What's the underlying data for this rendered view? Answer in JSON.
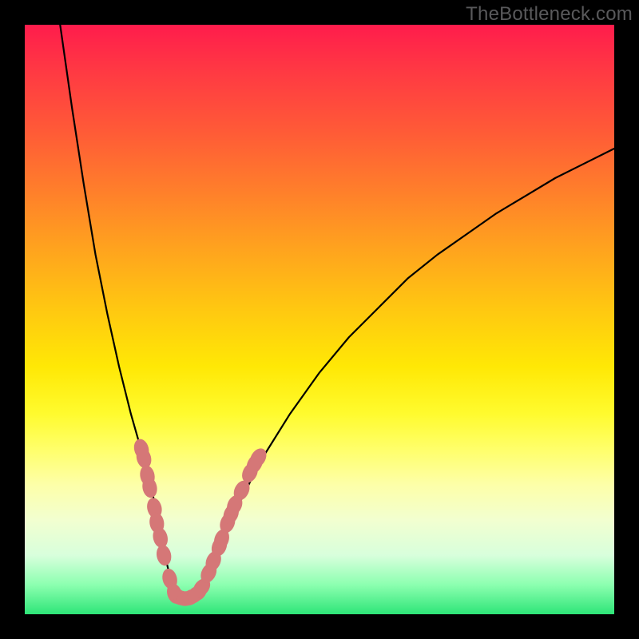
{
  "watermark": "TheBottleneck.com",
  "colors": {
    "frame": "#000000",
    "curve_stroke": "#000000",
    "marker_fill": "#D57777",
    "gradient_top": "#FF1C4C",
    "gradient_bottom": "#2EE578"
  },
  "chart_data": {
    "type": "line",
    "title": "",
    "xlabel": "",
    "ylabel": "",
    "xlim": [
      0,
      100
    ],
    "ylim": [
      0,
      100
    ],
    "grid": false,
    "series": [
      {
        "name": "bottleneck-curve",
        "x": [
          6.0,
          8.0,
          10.0,
          12.0,
          14.0,
          16.0,
          18.0,
          20.0,
          21.0,
          22.0,
          23.0,
          24.0,
          25.0,
          26.0,
          27.0,
          28.0,
          29.0,
          30.0,
          32.0,
          34.0,
          36.0,
          38.0,
          40.0,
          45.0,
          50.0,
          55.0,
          60.0,
          65.0,
          70.0,
          75.0,
          80.0,
          85.0,
          90.0,
          95.0,
          100.0
        ],
        "y": [
          100.0,
          86.0,
          73.0,
          61.0,
          51.0,
          42.0,
          34.0,
          27.0,
          23.5,
          19.0,
          14.0,
          9.0,
          5.0,
          3.0,
          2.5,
          2.5,
          3.0,
          4.0,
          8.0,
          13.0,
          18.0,
          22.0,
          26.0,
          34.0,
          41.0,
          47.0,
          52.0,
          57.0,
          61.0,
          64.5,
          68.0,
          71.0,
          74.0,
          76.5,
          79.0
        ]
      }
    ],
    "markers": {
      "name": "highlighted-points",
      "points": [
        {
          "x": 19.8,
          "y": 28.0
        },
        {
          "x": 20.2,
          "y": 26.5
        },
        {
          "x": 20.8,
          "y": 23.5
        },
        {
          "x": 21.2,
          "y": 21.5
        },
        {
          "x": 22.0,
          "y": 18.0
        },
        {
          "x": 22.4,
          "y": 15.5
        },
        {
          "x": 23.0,
          "y": 13.0
        },
        {
          "x": 23.6,
          "y": 10.0
        },
        {
          "x": 24.6,
          "y": 6.0
        },
        {
          "x": 25.4,
          "y": 3.5
        },
        {
          "x": 26.0,
          "y": 3.0
        },
        {
          "x": 26.8,
          "y": 2.7
        },
        {
          "x": 27.6,
          "y": 2.7
        },
        {
          "x": 28.4,
          "y": 3.0
        },
        {
          "x": 29.2,
          "y": 3.5
        },
        {
          "x": 30.0,
          "y": 4.5
        },
        {
          "x": 31.2,
          "y": 7.0
        },
        {
          "x": 32.0,
          "y": 9.0
        },
        {
          "x": 33.0,
          "y": 11.5
        },
        {
          "x": 33.4,
          "y": 12.7
        },
        {
          "x": 34.4,
          "y": 15.5
        },
        {
          "x": 35.0,
          "y": 17.0
        },
        {
          "x": 35.6,
          "y": 18.5
        },
        {
          "x": 36.8,
          "y": 21.0
        },
        {
          "x": 38.2,
          "y": 24.0
        },
        {
          "x": 39.0,
          "y": 25.5
        },
        {
          "x": 39.6,
          "y": 26.5
        }
      ]
    }
  }
}
